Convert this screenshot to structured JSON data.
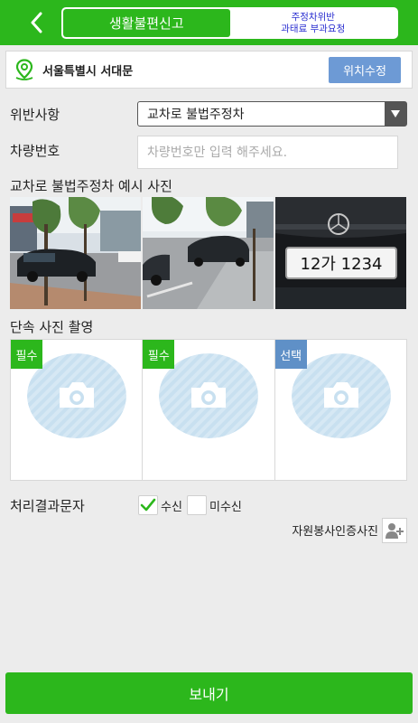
{
  "header": {
    "tabs": [
      {
        "label": "생활불편신고",
        "active": true
      },
      {
        "label_line1": "주정차위반",
        "label_line2": "과태료 부과요청",
        "active": false
      }
    ]
  },
  "location": {
    "address": "서울특별시 서대문",
    "button_label": "위치수정"
  },
  "form": {
    "violation_label": "위반사항",
    "violation_value": "교차로 불법주정차",
    "vehicle_label": "차량번호",
    "vehicle_placeholder": "차량번호만 입력 해주세요.",
    "vehicle_value": ""
  },
  "example": {
    "title": "교차로 불법주정차 예시 사진",
    "plate_text": "12가 1234"
  },
  "capture": {
    "title": "단속 사진 촬영",
    "slots": [
      {
        "badge": "필수",
        "badge_color": "#2cb71c"
      },
      {
        "badge": "필수",
        "badge_color": "#2cb71c"
      },
      {
        "badge": "선택",
        "badge_color": "#5f90c7"
      }
    ]
  },
  "sms": {
    "label": "처리결과문자",
    "receive_label": "수신",
    "receive_checked": true,
    "no_receive_label": "미수신",
    "no_receive_checked": false
  },
  "volunteer": {
    "label": "자원봉사인증사진"
  },
  "submit": {
    "label": "보내기"
  },
  "colors": {
    "brand_green": "#2cb71c",
    "button_blue": "#6d9ad5",
    "optional_blue": "#5f90c7"
  }
}
